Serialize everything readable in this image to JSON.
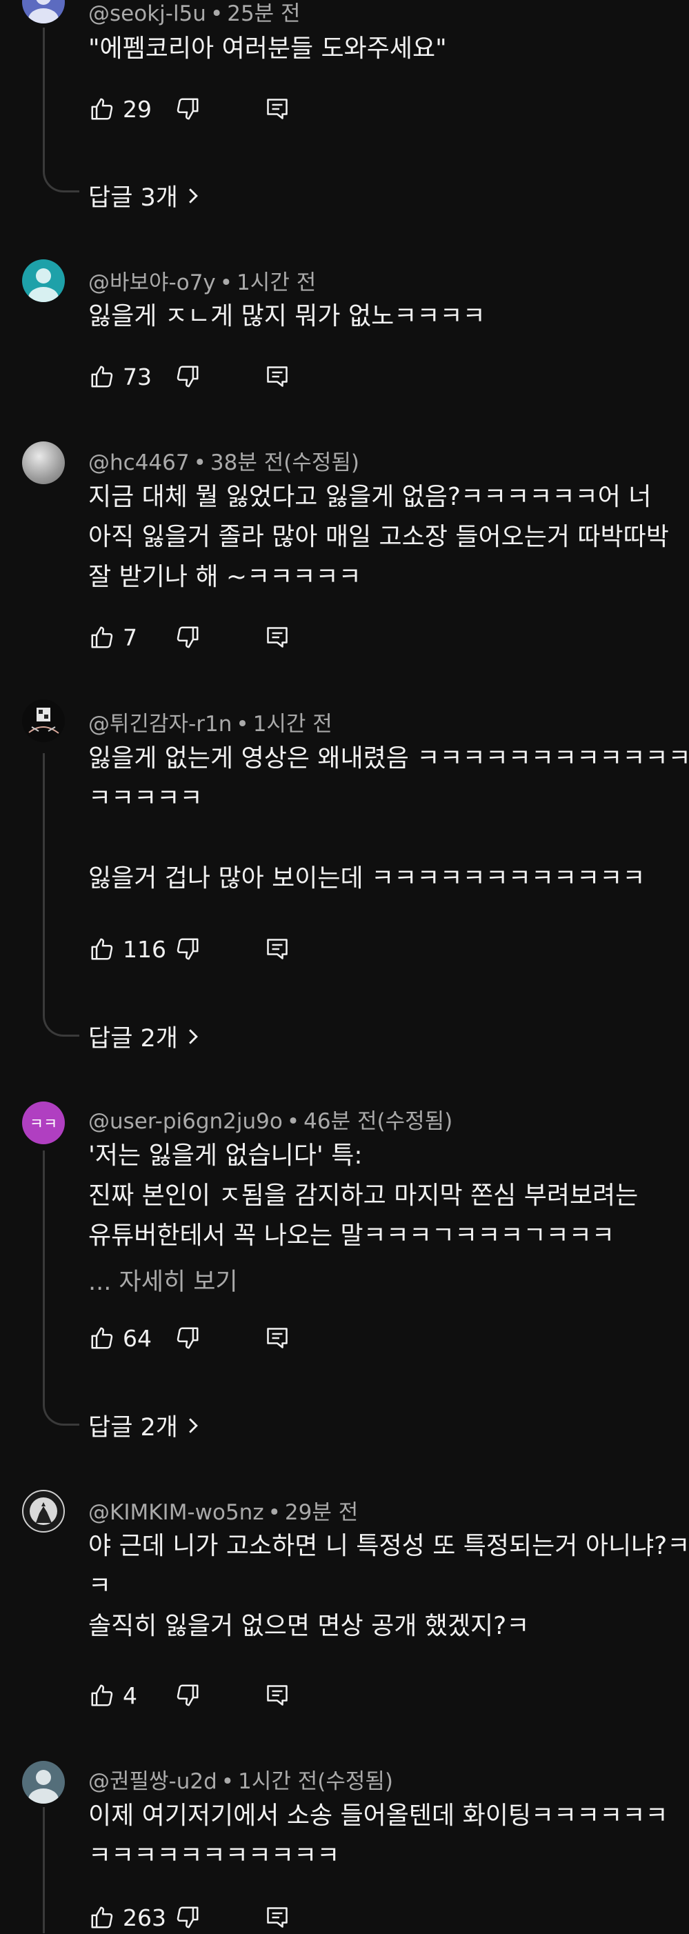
{
  "colors": {
    "background": "#0f0f0f",
    "text": "#f1f1f1",
    "muted": "#aaaaaa",
    "thread": "#3a3a3a"
  },
  "comments": [
    {
      "handle": "@seokj-l5u",
      "time": "25분 전",
      "lines": [
        "\"에펨코리아 여러분들 도와주세요\""
      ],
      "likes": "29",
      "replies": "답글 3개"
    },
    {
      "handle": "@바보야-o7y",
      "time": "1시간 전",
      "lines": [
        "잃을게 ㅈㄴ게 많지 뭐가 없노ㅋㅋㅋㅋ"
      ],
      "likes": "73"
    },
    {
      "handle": "@hc4467",
      "time": "38분 전(수정됨)",
      "lines": [
        "지금 대체 뭘 잃었다고 잃을게 없음?ㅋㅋㅋㅋㅋㅋ어 너",
        "아직 잃을거 졸라 많아 매일 고소장 들어오는거 따박따박",
        "잘 받기나 해 ~ㅋㅋㅋㅋㅋ"
      ],
      "likes": "7"
    },
    {
      "handle": "@튀긴감자-r1n",
      "time": "1시간 전",
      "lines": [
        "잃을게 없는게 영상은 왜내렸음 ㅋㅋㅋㅋㅋㅋㅋㅋㅋㅋㅋㅋ",
        "ㅋㅋㅋㅋㅋ",
        "",
        "잃을거 겁나 많아 보이는데 ㅋㅋㅋㅋㅋㅋㅋㅋㅋㅋㅋㅋ"
      ],
      "likes": "116",
      "replies": "답글 2개"
    },
    {
      "handle": "@user-pi6gn2ju9o",
      "time": "46분 전(수정됨)",
      "avatar_text": "ㅋㅋ",
      "lines": [
        "'저는 잃을게 없습니다' 특:",
        "진짜 본인이 ㅈ됨을 감지하고 마지막 쫀심 부려보려는",
        "유튜버한테서 꼭 나오는 말ㅋㅋㅋㄱㅋㅋㅋㄱㅋㅋㅋ"
      ],
      "more": "... 자세히 보기",
      "likes": "64",
      "replies": "답글 2개"
    },
    {
      "handle": "@KIMKIM-wo5nz",
      "time": "29분 전",
      "lines": [
        "야 근데 니가 고소하면 니 특정성 또 특정되는거 아니냐?ㅋ",
        "ㅋ",
        "솔직히 잃을거 없으면 면상 공개 했겠지?ㅋ"
      ],
      "likes": "4"
    },
    {
      "handle": "@권필쌍-u2d",
      "time": "1시간 전(수정됨)",
      "lines": [
        "이제 여기저기에서 소송 들어올텐데 화이팅ㅋㅋㅋㅋㅋㅋ",
        "ㅋㅋㅋㅋㅋㅋㅋㅋㅋㅋㅋ"
      ],
      "likes": "263"
    }
  ],
  "icons": {
    "like": "thumbs-up-icon",
    "dislike": "thumbs-down-icon",
    "reply": "reply-comment-icon",
    "more_replies": "chevron-right-icon"
  }
}
